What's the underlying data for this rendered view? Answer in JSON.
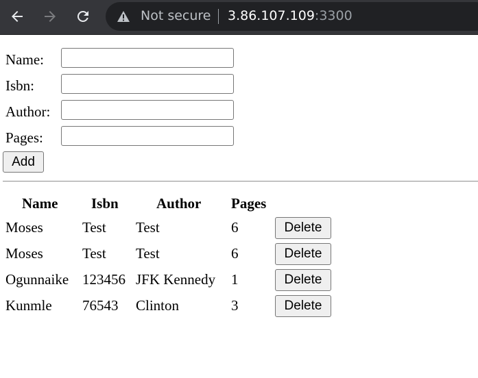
{
  "browser": {
    "security_label": "Not secure",
    "url_host": "3.86.107.109",
    "url_port": ":3300"
  },
  "form": {
    "fields": [
      {
        "label": "Name:",
        "value": ""
      },
      {
        "label": "Isbn:",
        "value": ""
      },
      {
        "label": "Author:",
        "value": ""
      },
      {
        "label": "Pages:",
        "value": ""
      }
    ],
    "add_label": "Add"
  },
  "table": {
    "headers": [
      "Name",
      "Isbn",
      "Author",
      "Pages"
    ],
    "rows": [
      {
        "name": "Moses",
        "isbn": "Test",
        "author": "Test",
        "pages": "6",
        "action": "Delete"
      },
      {
        "name": "Moses",
        "isbn": "Test",
        "author": "Test",
        "pages": "6",
        "action": "Delete"
      },
      {
        "name": "Ogunnaike",
        "isbn": "123456",
        "author": "JFK Kennedy",
        "pages": "1",
        "action": "Delete"
      },
      {
        "name": "Kunmle",
        "isbn": "76543",
        "author": "Clinton",
        "pages": "3",
        "action": "Delete"
      }
    ]
  }
}
